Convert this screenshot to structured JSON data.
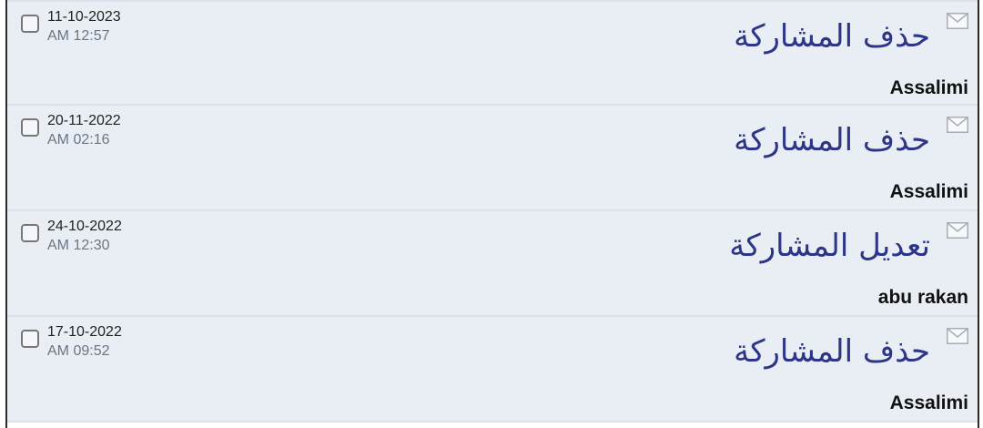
{
  "messages": [
    {
      "date": "11-10-2023",
      "time": "AM 12:57",
      "title": "حذف المشاركة",
      "author": "Assalimi",
      "icon": "envelope-icon"
    },
    {
      "date": "20-11-2022",
      "time": "AM 02:16",
      "title": "حذف المشاركة",
      "author": "Assalimi",
      "icon": "envelope-icon"
    },
    {
      "date": "24-10-2022",
      "time": "AM 12:30",
      "title": "تعديل المشاركة",
      "author": "abu rakan",
      "icon": "envelope-icon"
    },
    {
      "date": "17-10-2022",
      "time": "AM 09:52",
      "title": "حذف المشاركة",
      "author": "Assalimi",
      "icon": "envelope-icon"
    }
  ]
}
